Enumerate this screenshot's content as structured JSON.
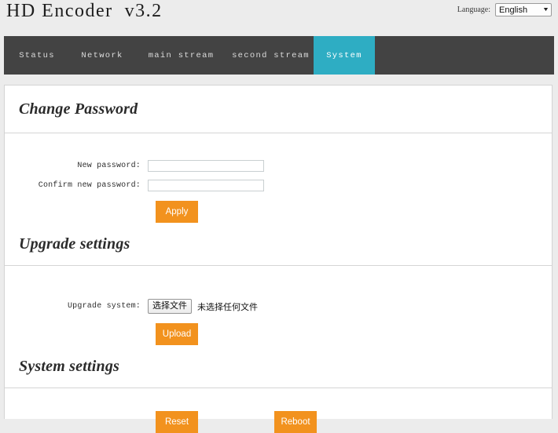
{
  "header": {
    "app_title": "HD Encoder  v3.2",
    "language_label": "Language:",
    "language_value": "English",
    "caret_icon": "▼"
  },
  "nav": {
    "items": [
      {
        "label": "Status",
        "active": false
      },
      {
        "label": "Network",
        "active": false
      },
      {
        "label": "main stream",
        "active": false
      },
      {
        "label": "second stream",
        "active": false
      },
      {
        "label": "System",
        "active": true
      }
    ],
    "active_color": "#2eadc3",
    "bar_color": "#434343"
  },
  "change_password": {
    "heading": "Change Password",
    "new_password_label": "New password:",
    "new_password_value": "",
    "confirm_password_label": "Confirm new password:",
    "confirm_password_value": "",
    "apply_label": "Apply"
  },
  "upgrade_settings": {
    "heading": "Upgrade settings",
    "upgrade_system_label": "Upgrade system:",
    "choose_file_label": "选择文件",
    "no_file_text": "未选择任何文件",
    "upload_label": "Upload"
  },
  "system_settings": {
    "heading": "System settings",
    "reset_label": "Reset",
    "reboot_label": "Reboot"
  },
  "colors": {
    "accent_orange": "#f2921e",
    "accent_teal": "#2eadc3",
    "nav_dark": "#434343",
    "page_bg": "#ececec"
  }
}
